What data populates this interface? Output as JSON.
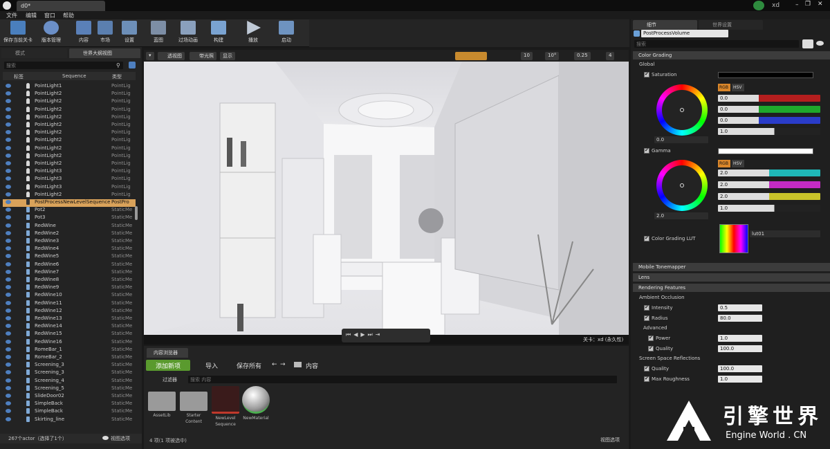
{
  "window": {
    "tab_title": "d0*",
    "user": "xd"
  },
  "menu": [
    "文件",
    "编辑",
    "窗口",
    "帮助"
  ],
  "toolbar": [
    {
      "label": "保存当前关卡",
      "color": "#4a7fbd"
    },
    {
      "label": "版本管理",
      "color": "#6b8fc7"
    },
    {
      "label": "内容",
      "color": "#5a80b8"
    },
    {
      "label": "市场",
      "color": "#5b7faf"
    },
    {
      "label": "设置",
      "color": "#6d8fb8"
    },
    {
      "label": "蓝图",
      "color": "#7d8ea5"
    },
    {
      "label": "过场动画",
      "color": "#8aa0bd"
    },
    {
      "label": "构建",
      "color": "#7aa3d1"
    },
    {
      "label": "播放",
      "color": "#bfc9d6"
    },
    {
      "label": "启动",
      "color": "#6e93c0"
    }
  ],
  "left_panel": {
    "tabs": [
      "模式",
      "世界大纲视图"
    ],
    "search_placeholder": "搜索",
    "headers": {
      "label": "标签",
      "sequence": "Sequence",
      "type": "类型"
    },
    "rows": [
      {
        "name": "PointLight1",
        "type": "PointLig",
        "kind": "light"
      },
      {
        "name": "PointLight2",
        "type": "PointLig",
        "kind": "light"
      },
      {
        "name": "PointLight2",
        "type": "PointLig",
        "kind": "light"
      },
      {
        "name": "PointLight2",
        "type": "PointLig",
        "kind": "light"
      },
      {
        "name": "PointLight2",
        "type": "PointLig",
        "kind": "light"
      },
      {
        "name": "PointLight2",
        "type": "PointLig",
        "kind": "light"
      },
      {
        "name": "PointLight2",
        "type": "PointLig",
        "kind": "light"
      },
      {
        "name": "PointLight2",
        "type": "PointLig",
        "kind": "light"
      },
      {
        "name": "PointLight2",
        "type": "PointLig",
        "kind": "light"
      },
      {
        "name": "PointLight2",
        "type": "PointLig",
        "kind": "light"
      },
      {
        "name": "PointLight2",
        "type": "PointLig",
        "kind": "light"
      },
      {
        "name": "PointLight3",
        "type": "PointLig",
        "kind": "light"
      },
      {
        "name": "PointLight3",
        "type": "PointLig",
        "kind": "light"
      },
      {
        "name": "PointLight3",
        "type": "PointLig",
        "kind": "light"
      },
      {
        "name": "PointLight2",
        "type": "PointLig",
        "kind": "light"
      },
      {
        "name": "PostProcessNewLevelSequence",
        "type": "PostPro",
        "kind": "pp",
        "selected": true
      },
      {
        "name": "Pot2",
        "type": "StaticMe",
        "kind": "mesh"
      },
      {
        "name": "Pot3",
        "type": "StaticMe",
        "kind": "mesh"
      },
      {
        "name": "RedWine",
        "type": "StaticMe",
        "kind": "mesh"
      },
      {
        "name": "RedWine2",
        "type": "StaticMe",
        "kind": "mesh"
      },
      {
        "name": "RedWine3",
        "type": "StaticMe",
        "kind": "mesh"
      },
      {
        "name": "RedWine4",
        "type": "StaticMe",
        "kind": "mesh"
      },
      {
        "name": "RedWine5",
        "type": "StaticMe",
        "kind": "mesh"
      },
      {
        "name": "RedWine6",
        "type": "StaticMe",
        "kind": "mesh"
      },
      {
        "name": "RedWine7",
        "type": "StaticMe",
        "kind": "mesh"
      },
      {
        "name": "RedWine8",
        "type": "StaticMe",
        "kind": "mesh"
      },
      {
        "name": "RedWine9",
        "type": "StaticMe",
        "kind": "mesh"
      },
      {
        "name": "RedWine10",
        "type": "StaticMe",
        "kind": "mesh"
      },
      {
        "name": "RedWine11",
        "type": "StaticMe",
        "kind": "mesh"
      },
      {
        "name": "RedWine12",
        "type": "StaticMe",
        "kind": "mesh"
      },
      {
        "name": "RedWine13",
        "type": "StaticMe",
        "kind": "mesh"
      },
      {
        "name": "RedWine14",
        "type": "StaticMe",
        "kind": "mesh"
      },
      {
        "name": "RedWine15",
        "type": "StaticMe",
        "kind": "mesh"
      },
      {
        "name": "RedWine16",
        "type": "StaticMe",
        "kind": "mesh"
      },
      {
        "name": "RomeBar_1",
        "type": "StaticMe",
        "kind": "mesh"
      },
      {
        "name": "RomeBar_2",
        "type": "StaticMe",
        "kind": "mesh"
      },
      {
        "name": "Screening_3",
        "type": "StaticMe",
        "kind": "mesh"
      },
      {
        "name": "Screening_3",
        "type": "StaticMe",
        "kind": "mesh"
      },
      {
        "name": "Screening_4",
        "type": "StaticMe",
        "kind": "mesh"
      },
      {
        "name": "Screening_5",
        "type": "StaticMe",
        "kind": "mesh"
      },
      {
        "name": "SlideDoor02",
        "type": "StaticMe",
        "kind": "mesh"
      },
      {
        "name": "SimpleBack",
        "type": "StaticMe",
        "kind": "mesh"
      },
      {
        "name": "SimpleBack",
        "type": "StaticMe",
        "kind": "mesh"
      },
      {
        "name": "Skirting_line",
        "type": "StaticMe",
        "kind": "mesh"
      }
    ],
    "footer": "267个actor（选择了1个）",
    "view_options": "视图选项"
  },
  "viewport": {
    "buttons": [
      "透视图",
      "带光照",
      "显示"
    ],
    "snap": [
      "10",
      "10°",
      "0.25",
      "4"
    ],
    "level_label": "关卡：",
    "level_value": "xd (永久性)"
  },
  "content_browser": {
    "tab": "内容浏览器",
    "add_new": "添加新项",
    "import": "导入",
    "save_all": "保存所有",
    "path": "内容",
    "filters": "过滤器",
    "search_placeholder": "搜索 内容",
    "assets": [
      {
        "label": "AssetLib",
        "kind": "folder"
      },
      {
        "label": "Starter Content",
        "kind": "folder"
      },
      {
        "label": "NewLevel Sequence",
        "kind": "sequence"
      },
      {
        "label": "NewMaterial",
        "kind": "material"
      }
    ],
    "footer": "4 项(1 项被选中)",
    "view_options": "视图选项"
  },
  "details": {
    "tabs": [
      "细节",
      "世界设置"
    ],
    "actor_name": "PostProcessVolume",
    "search_placeholder": "搜索",
    "color_grading": {
      "title": "Color Grading",
      "global": "Global",
      "saturation": {
        "label": "Saturation",
        "wheel_value": "0.0",
        "r": "0.0",
        "g": "0.0",
        "b": "0.0",
        "y": "1.0"
      },
      "gamma": {
        "label": "Gamma",
        "wheel_value": "2.0",
        "r": "2.0",
        "g": "2.0",
        "b": "2.0",
        "y": "1.0"
      },
      "rgb": "RGB",
      "hsv": "HSV",
      "lut_label": "Color Grading LUT",
      "lut_value": "lut01"
    },
    "mobile_tonemapper": "Mobile Tonemapper",
    "lens": "Lens",
    "rendering": {
      "title": "Rendering Features",
      "ao": "Ambient Occlusion",
      "intensity_label": "Intensity",
      "intensity": "0.5",
      "radius_label": "Radius",
      "radius": "80.0",
      "advanced": "Advanced",
      "power_label": "Power",
      "power": "1.0",
      "quality_label": "Quality",
      "quality": "100.0",
      "ssr": "Screen Space Reflections",
      "ssr_quality_label": "Quality",
      "ssr_quality": "100.0",
      "max_rough_label": "Max Roughness",
      "max_rough": "1.0"
    }
  },
  "watermark": {
    "cn": "引擎世界",
    "en": "Engine World . CN"
  }
}
